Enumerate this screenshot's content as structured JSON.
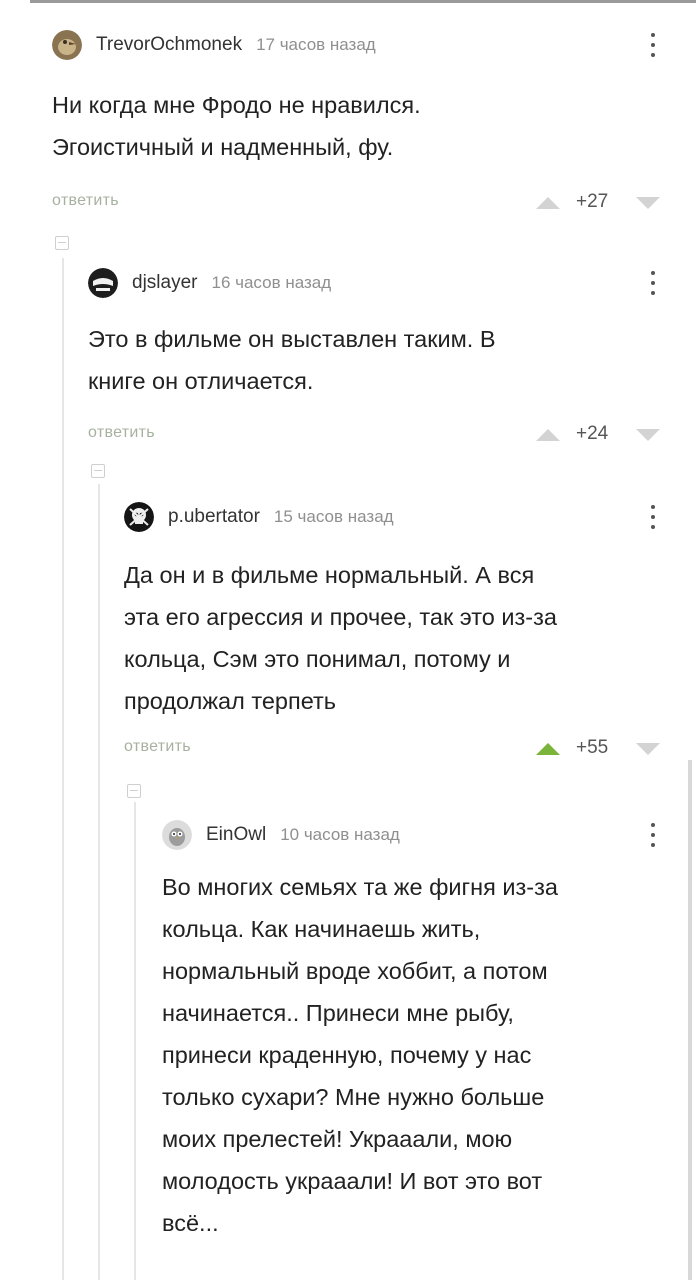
{
  "comments": [
    {
      "author": "TrevorOchmonek",
      "time": "17 часов назад",
      "text": "Ни когда мне Фродо не нравился.\nЭгоистичный и надменный, фу.",
      "reply_label": "ответить",
      "score": "+27",
      "upvoted": false
    },
    {
      "author": "djslayer",
      "time": "16 часов назад",
      "text": "Это в фильме он выставлен таким. В\nкниге он отличается.",
      "reply_label": "ответить",
      "score": "+24",
      "upvoted": false
    },
    {
      "author": "p.ubertator",
      "time": "15 часов назад",
      "text": "Да он и в фильме нормальный. А вся\nэта его агрессия и прочее, так это из-за\nкольца, Сэм это понимал, потому и\nпродолжал терпеть",
      "reply_label": "ответить",
      "score": "+55",
      "upvoted": true
    },
    {
      "author": "EinOwl",
      "time": "10 часов назад",
      "text": "Во многих семьях та же фигня из-за\nкольца. Как начинаешь жить,\nнормальный вроде хоббит, а потом\nначинается.. Принеси мне рыбу,\nпринеси краденную, почему у нас\nтолько сухари? Мне нужно больше\nмоих прелестей! Украаали, мою\nмолодость украаали! И вот это вот\nвсё..."
    }
  ],
  "colors": {
    "upvote_active": "#7bb43b",
    "vote_inactive": "#d3d3d3",
    "reply_link": "#a7b1a0",
    "time_text": "#8f8f8f"
  },
  "icons": {
    "avatars": [
      "bird-avatar-icon",
      "mask-avatar-icon",
      "skull-avatar-icon",
      "owl-avatar-icon"
    ],
    "menu": "more-vertical-icon",
    "upvote": "arrow-up-icon",
    "downvote": "arrow-down-icon",
    "collapse": "collapse-thread-icon"
  }
}
